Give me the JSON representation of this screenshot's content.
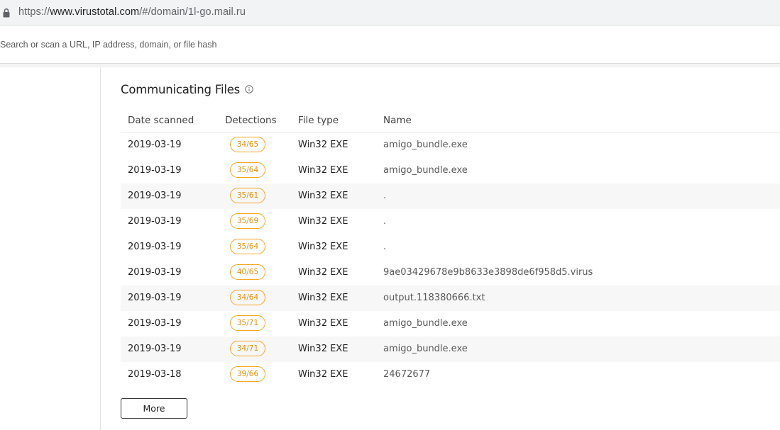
{
  "browser": {
    "url_prefix": "https://",
    "url_host": "www.virustotal.com",
    "url_path": "/#/domain/1l-go.mail.ru"
  },
  "search": {
    "placeholder": "Search or scan a URL, IP address, domain, or file hash"
  },
  "section": {
    "title": "Communicating Files",
    "info_icon": "info-circle-icon"
  },
  "table": {
    "columns": [
      "Date scanned",
      "Detections",
      "File type",
      "Name"
    ],
    "rows": [
      {
        "date": "2019-03-19",
        "detections": "34/65",
        "file_type": "Win32 EXE",
        "name": "amigo_bundle.exe"
      },
      {
        "date": "2019-03-19",
        "detections": "35/64",
        "file_type": "Win32 EXE",
        "name": "amigo_bundle.exe"
      },
      {
        "date": "2019-03-19",
        "detections": "35/61",
        "file_type": "Win32 EXE",
        "name": "."
      },
      {
        "date": "2019-03-19",
        "detections": "35/69",
        "file_type": "Win32 EXE",
        "name": "."
      },
      {
        "date": "2019-03-19",
        "detections": "35/64",
        "file_type": "Win32 EXE",
        "name": "."
      },
      {
        "date": "2019-03-19",
        "detections": "40/65",
        "file_type": "Win32 EXE",
        "name": "9ae03429678e9b8633e3898de6f958d5.virus"
      },
      {
        "date": "2019-03-19",
        "detections": "34/64",
        "file_type": "Win32 EXE",
        "name": "output.118380666.txt"
      },
      {
        "date": "2019-03-19",
        "detections": "35/71",
        "file_type": "Win32 EXE",
        "name": "amigo_bundle.exe"
      },
      {
        "date": "2019-03-19",
        "detections": "34/71",
        "file_type": "Win32 EXE",
        "name": "amigo_bundle.exe"
      },
      {
        "date": "2019-03-18",
        "detections": "39/66",
        "file_type": "Win32 EXE",
        "name": "24672677"
      }
    ]
  },
  "more_button": {
    "label": "More"
  },
  "colors": {
    "detection_badge": "#f5a623",
    "row_stripe": "#f7f7f7"
  }
}
